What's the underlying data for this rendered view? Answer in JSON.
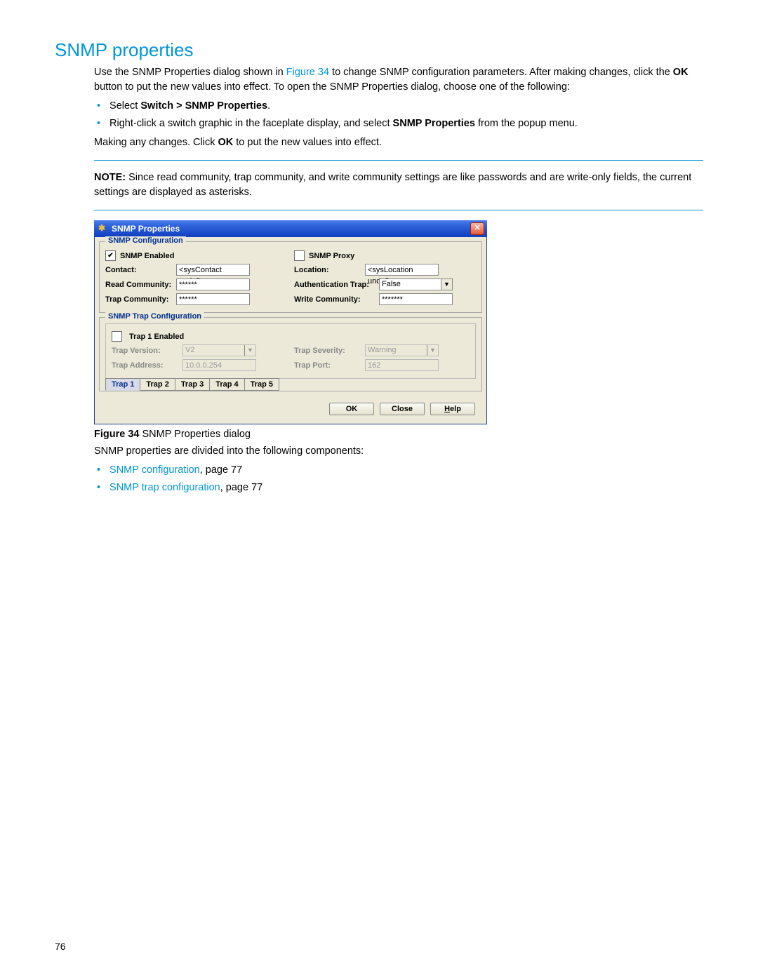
{
  "heading": "SNMP properties",
  "para1_a": "Use the SNMP Properties dialog shown in ",
  "para1_link": "Figure 34",
  "para1_b": " to change SNMP configuration parameters. After making changes, click the ",
  "para1_bold1": "OK",
  "para1_c": " button to put the new values into effect. To open the SNMP Properties dialog, choose one of the following:",
  "bullet1_a": "Select ",
  "bullet1_bold": "Switch > SNMP Properties",
  "bullet1_b": ".",
  "bullet2_a": "Right-click a switch graphic in the faceplate display, and select ",
  "bullet2_bold": "SNMP Properties",
  "bullet2_b": " from the popup menu.",
  "para2_a": "Making any changes. Click ",
  "para2_bold": "OK",
  "para2_b": " to put the new values into effect.",
  "note_label": "NOTE:",
  "note_text": "   Since read community, trap community, and write community settings are like passwords and are write-only fields, the current settings are displayed as asterisks.",
  "dialog": {
    "title": "SNMP Properties",
    "group1_legend": "SNMP Configuration",
    "snmp_enabled_checked": "✔",
    "snmp_enabled_label": "SNMP Enabled",
    "snmp_proxy_label": "SNMP Proxy",
    "contact_label": "Contact:",
    "contact_value": "<sysContact undefin",
    "location_label": "Location:",
    "location_value": "<sysLocation undefi",
    "read_comm_label": "Read Community:",
    "read_comm_value": "******",
    "auth_trap_label": "Authentication Trap:",
    "auth_trap_value": "False",
    "trap_comm_label": "Trap Community:",
    "trap_comm_value": "******",
    "write_comm_label": "Write Community:",
    "write_comm_value": "*******",
    "group2_legend": "SNMP Trap Configuration",
    "trap1_enabled_label": "Trap 1 Enabled",
    "trap_version_label": "Trap Version:",
    "trap_version_value": "V2",
    "trap_severity_label": "Trap Severity:",
    "trap_severity_value": "Warning",
    "trap_address_label": "Trap Address:",
    "trap_address_value": "10.0.0.254",
    "trap_port_label": "Trap Port:",
    "trap_port_value": "162",
    "tabs": [
      "Trap 1",
      "Trap 2",
      "Trap 3",
      "Trap 4",
      "Trap 5"
    ],
    "ok": "OK",
    "close": "Close",
    "help_u": "H",
    "help_rest": "elp"
  },
  "caption_label": "Figure 34",
  "caption_text": "  SNMP Properties dialog",
  "para3": "SNMP properties are divided into the following components:",
  "link_bullet1_a": "SNMP configuration",
  "link_bullet1_b": ", page 77",
  "link_bullet2_a": "SNMP trap configuration",
  "link_bullet2_b": ", page 77",
  "pagenum": "76"
}
